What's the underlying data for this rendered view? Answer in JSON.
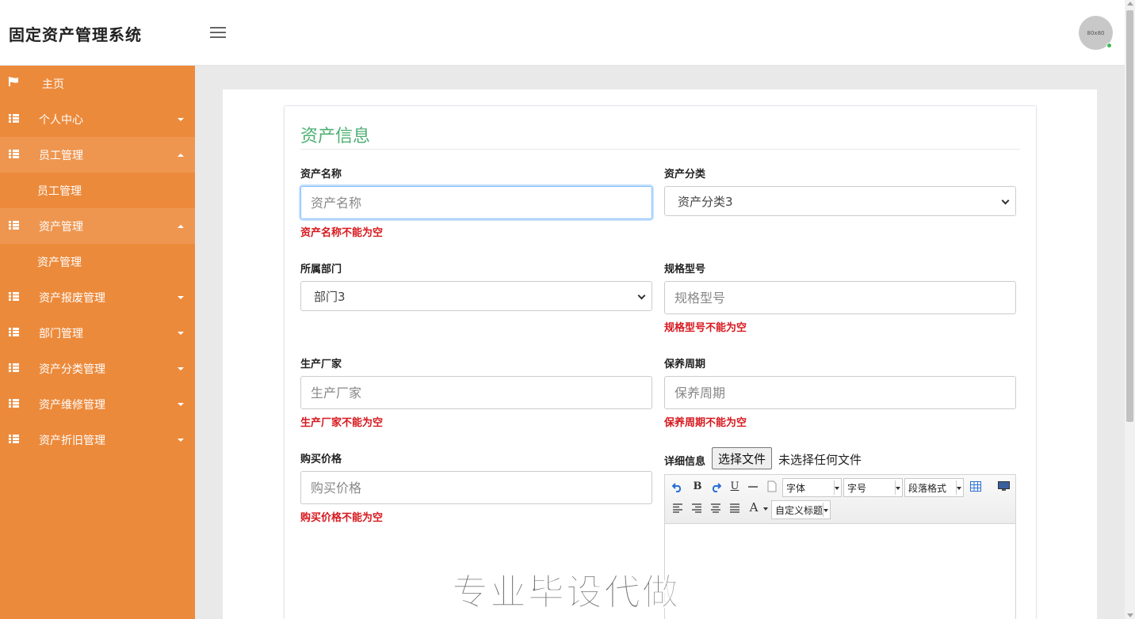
{
  "header": {
    "app_title": "固定资产管理系统",
    "avatar_text": "80x80"
  },
  "sidebar": {
    "items": [
      {
        "label": "主页",
        "icon": "flag-icon"
      },
      {
        "label": "个人中心",
        "icon": "grid-icon"
      },
      {
        "label": "员工管理",
        "icon": "grid-icon",
        "sub": "员工管理"
      },
      {
        "label": "资产管理",
        "icon": "grid-icon",
        "sub": "资产管理"
      },
      {
        "label": "资产报废管理",
        "icon": "grid-icon"
      },
      {
        "label": "部门管理",
        "icon": "grid-icon"
      },
      {
        "label": "资产分类管理",
        "icon": "grid-icon"
      },
      {
        "label": "资产维修管理",
        "icon": "grid-icon"
      },
      {
        "label": "资产折旧管理",
        "icon": "grid-icon"
      }
    ]
  },
  "form": {
    "title": "资产信息",
    "asset_name": {
      "label": "资产名称",
      "placeholder": "资产名称",
      "error": "资产名称不能为空"
    },
    "asset_category": {
      "label": "资产分类",
      "value": "资产分类3"
    },
    "department": {
      "label": "所属部门",
      "value": "部门3"
    },
    "spec_model": {
      "label": "规格型号",
      "placeholder": "规格型号",
      "error": "规格型号不能为空"
    },
    "manufacturer": {
      "label": "生产厂家",
      "placeholder": "生产厂家",
      "error": "生产厂家不能为空"
    },
    "maintenance_period": {
      "label": "保养周期",
      "placeholder": "保养周期",
      "error": "保养周期不能为空"
    },
    "purchase_price": {
      "label": "购买价格",
      "placeholder": "购买价格",
      "error": "购买价格不能为空"
    },
    "details": {
      "label": "详细信息",
      "file_button": "选择文件",
      "file_status": "未选择任何文件"
    }
  },
  "editor": {
    "bold": "B",
    "underline": "U",
    "font_family": "字体",
    "font_size": "字号",
    "paragraph": "段落格式",
    "font_color": "A",
    "custom_title": "自定义标题"
  },
  "watermark": "专业毕设代做",
  "colors": {
    "sidebar": "#ec8a3b",
    "accent": "#4caf73",
    "error": "#d6181e"
  }
}
